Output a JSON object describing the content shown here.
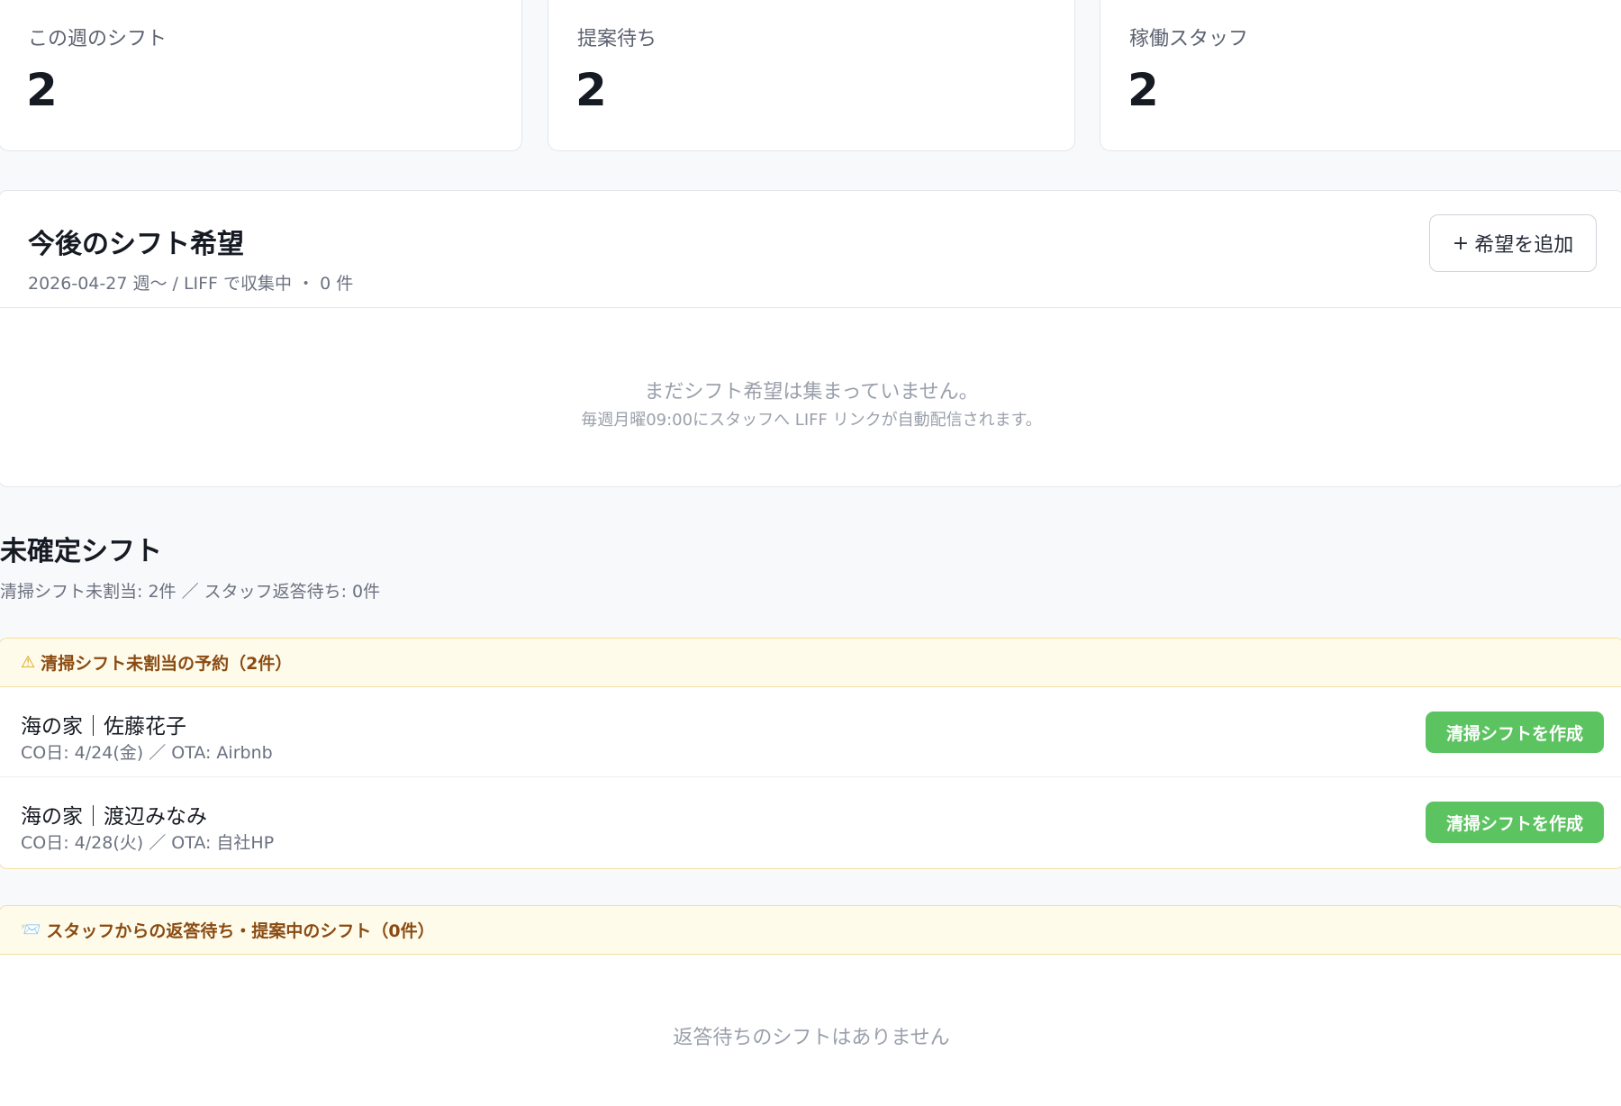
{
  "stats": [
    {
      "label": "この週のシフト",
      "value": "2"
    },
    {
      "label": "提案待ち",
      "value": "2"
    },
    {
      "label": "稼働スタッフ",
      "value": "2"
    }
  ],
  "wishes": {
    "title": "今後のシフト希望",
    "subtitle": "2026-04-27 週〜 / LIFF で収集中 ・ 0 件",
    "add_button_icon": "+",
    "add_button_label": "希望を追加",
    "empty_main": "まだシフト希望は集まっていません。",
    "empty_sub": "毎週月曜09:00にスタッフへ LIFF リンクが自動配信されます。"
  },
  "pending": {
    "title": "未確定シフト",
    "subtitle": "清掃シフト未割当: 2件 ／ スタッフ返答待ち: 0件"
  },
  "unassigned": {
    "icon": "⚠",
    "header": "清掃シフト未割当の予約（2件）",
    "rows": [
      {
        "title": "海の家｜佐藤花子",
        "meta": "CO日: 4/24(金) ／ OTA: Airbnb",
        "button": "清掃シフトを作成"
      },
      {
        "title": "海の家｜渡辺みなみ",
        "meta": "CO日: 4/28(火) ／ OTA: 自社HP",
        "button": "清掃シフトを作成"
      }
    ]
  },
  "awaiting": {
    "icon": "📨",
    "header": "スタッフからの返答待ち・提案中のシフト（0件）",
    "empty": "返答待ちのシフトはありません"
  },
  "colors": {
    "accent_green": "#5cc361",
    "warn_bg": "#fffbea",
    "warn_text": "#8a4b12"
  }
}
